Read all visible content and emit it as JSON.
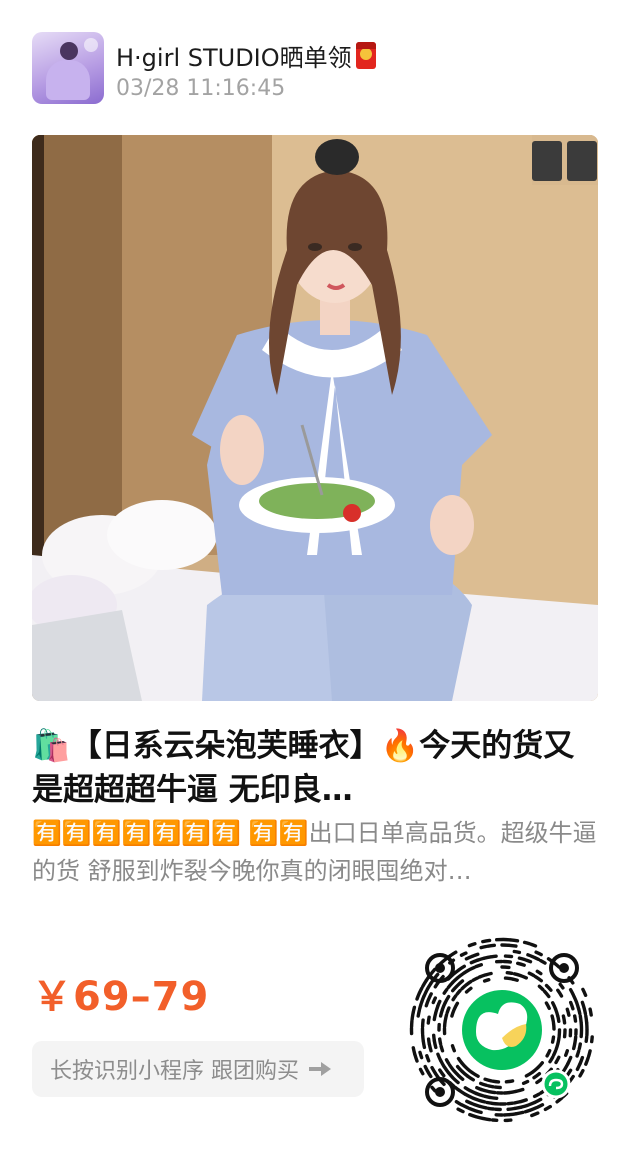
{
  "header": {
    "shop_name": "H·girl STUDIO晒单领",
    "timestamp": "03/28 11:16:45"
  },
  "product": {
    "title": "🛍️【日系云朵泡芙睡衣】🔥今天的货又是超超超牛逼 无印良…",
    "description": "🈶🈶🈶🈶🈶🈶🈶 🈶🈶出口日单高品货。超级牛逼的货 舒服到炸裂今晚你真的闭眼囤绝对…",
    "price": "￥69–79",
    "hint": "长按识别小程序 跟团购买"
  },
  "icons": {
    "badge": "red-envelope-icon",
    "hint_arrow": "arrow-right-icon",
    "mini_program": "wechat-mini-program-icon"
  },
  "colors": {
    "price": "#f25f2a",
    "mini_program_green": "#07c160",
    "title": "#111111",
    "muted": "#a3a3a3"
  }
}
